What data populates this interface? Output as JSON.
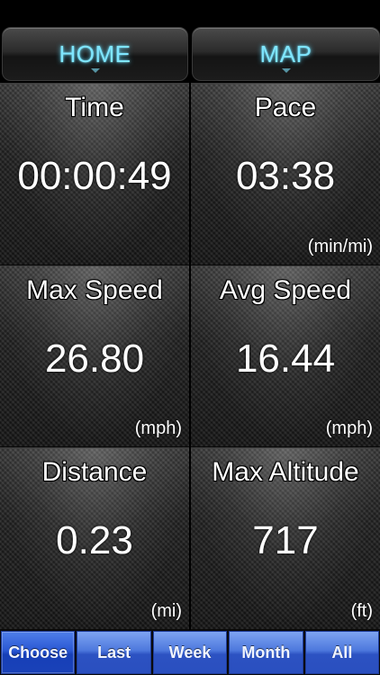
{
  "nav": {
    "home_label": "HOME",
    "map_label": "MAP"
  },
  "tiles": [
    {
      "label": "Time",
      "value": "00:00:49",
      "unit": ""
    },
    {
      "label": "Pace",
      "value": "03:38",
      "unit": "(min/mi)"
    },
    {
      "label": "Max Speed",
      "value": "26.80",
      "unit": "(mph)"
    },
    {
      "label": "Avg Speed",
      "value": "16.44",
      "unit": "(mph)"
    },
    {
      "label": "Distance",
      "value": "0.23",
      "unit": "(mi)"
    },
    {
      "label": "Max Altitude",
      "value": "717",
      "unit": "(ft)"
    }
  ],
  "tabs": [
    {
      "label": "Choose",
      "active": true
    },
    {
      "label": "Last",
      "active": false
    },
    {
      "label": "Week",
      "active": false
    },
    {
      "label": "Month",
      "active": false
    },
    {
      "label": "All",
      "active": false
    }
  ],
  "colors": {
    "nav_text": "#7fe6ff",
    "tab_blue": "#2c52c2",
    "tab_active": "#1a42b8"
  }
}
